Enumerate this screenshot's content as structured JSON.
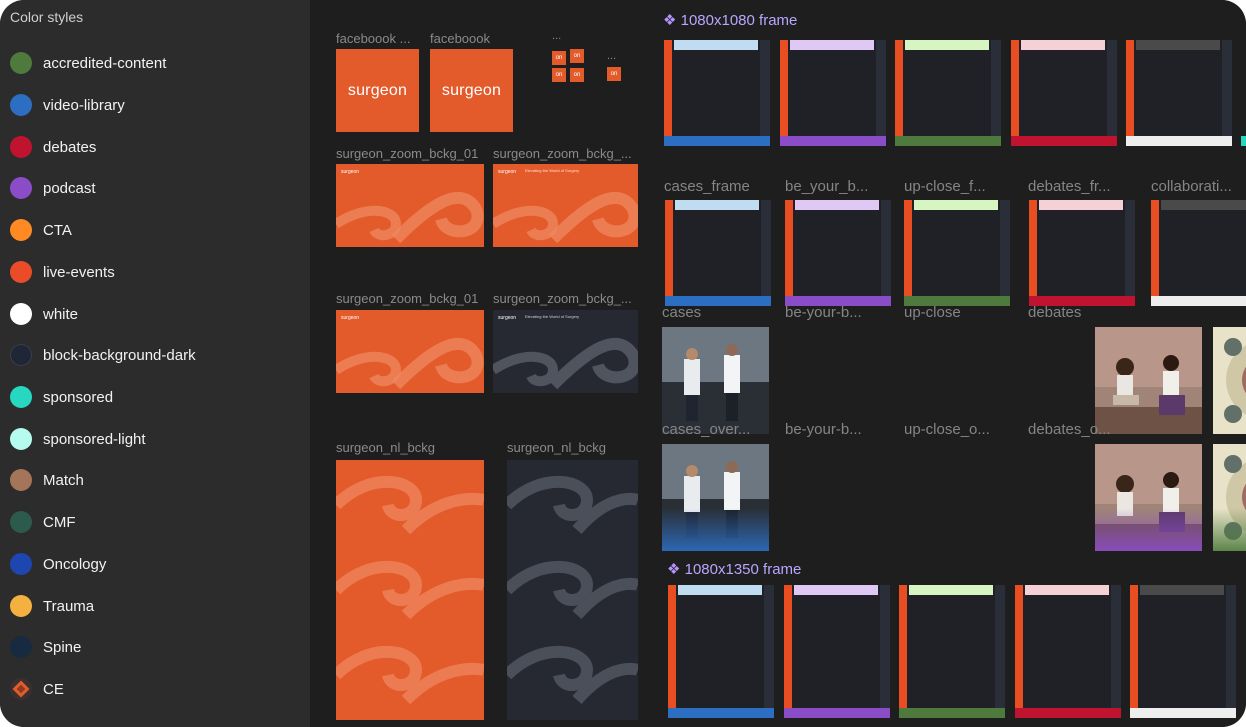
{
  "sidebar": {
    "title": "Color styles",
    "styles": [
      {
        "label": "accredited-content",
        "color": "#4e7a3d"
      },
      {
        "label": "video-library",
        "color": "#2c6ec1"
      },
      {
        "label": "debates",
        "color": "#c0132f"
      },
      {
        "label": "podcast",
        "color": "#8b4cc7"
      },
      {
        "label": "CTA",
        "color": "#ff8a24"
      },
      {
        "label": "live-events",
        "color": "#ea4c2a"
      },
      {
        "label": "white",
        "color": "#ffffff"
      },
      {
        "label": "block-background-dark",
        "color": "#1f2636"
      },
      {
        "label": "sponsored",
        "color": "#27d7c0"
      },
      {
        "label": "sponsored-light",
        "color": "#b6fbf0"
      },
      {
        "label": "Match",
        "color": "#a47558"
      },
      {
        "label": "CMF",
        "color": "#2c5a4c"
      },
      {
        "label": "Oncology",
        "color": "#1e46b0"
      },
      {
        "label": "Trauma",
        "color": "#f5b13f"
      },
      {
        "label": "Spine",
        "color": "#172a40"
      },
      {
        "label": "CE",
        "color": "#e35a2b"
      }
    ]
  },
  "canvas": {
    "facebook": [
      {
        "label": "faceboook ...",
        "logo": "surgeon"
      },
      {
        "label": "faceboook",
        "logo": "surgeon"
      }
    ],
    "mini_icons": {
      "label1": "...",
      "label2": "...",
      "glyph": "on"
    },
    "zoom_row1": [
      "surgeon_zoom_bckg_01",
      "surgeon_zoom_bckg_..."
    ],
    "zoom_row2": [
      "surgeon_zoom_bckg_01",
      "surgeon_zoom_bckg_..."
    ],
    "nl_row": [
      "surgeon_nl_bckg",
      "surgeon_nl_bckg"
    ],
    "zoom_mini_logo": "surgeon",
    "zoom_caption": "Elevating the World of Surgery",
    "frame_1080_title": "1080x1080 frame",
    "frame_1350_title": "1080x1350 frame",
    "frame_colors": [
      {
        "top": "#c0dcf0",
        "bottom": "#2c6ec1"
      },
      {
        "top": "#e0c8f5",
        "bottom": "#8b4cc7"
      },
      {
        "top": "#d6f5c0",
        "bottom": "#4e7a3d"
      },
      {
        "top": "#f5d0d6",
        "bottom": "#c0132f"
      },
      {
        "top": "#4a4a4a",
        "bottom": "#eeeeee"
      }
    ],
    "frame_labels": [
      "cases_frame",
      "be_your_b...",
      "up-close_f...",
      "debates_fr...",
      "collaborati..."
    ],
    "photo_labels_row1": [
      "cases",
      "be-your-b...",
      "up-close",
      "debates"
    ],
    "photo_labels_row2": [
      "cases_over...",
      "be-your-b...",
      "up-close_o...",
      "debates_o..."
    ]
  }
}
